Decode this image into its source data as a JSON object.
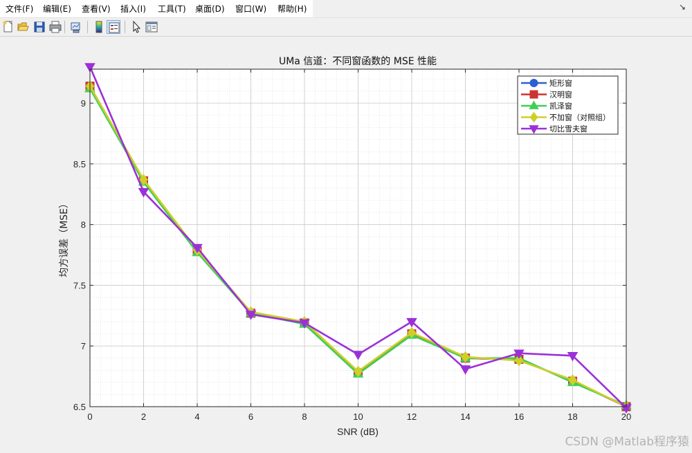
{
  "menu": {
    "items": [
      "文件(F)",
      "编辑(E)",
      "查看(V)",
      "插入(I)",
      "工具(T)",
      "桌面(D)",
      "窗口(W)",
      "帮助(H)"
    ],
    "dock_glyph": "↘"
  },
  "toolbar": {
    "buttons": [
      {
        "name": "new-figure-icon"
      },
      {
        "name": "open-file-icon"
      },
      {
        "name": "save-icon"
      },
      {
        "name": "print-icon"
      },
      {
        "name": "link-plot-icon"
      },
      {
        "name": "colorbar-icon"
      },
      {
        "name": "legend-icon",
        "pressed": true
      },
      {
        "name": "pointer-icon"
      },
      {
        "name": "property-editor-icon"
      }
    ]
  },
  "watermark": "CSDN @Matlab程序猿",
  "chart_data": {
    "type": "line",
    "title": "UMa 信道：不同窗函数的 MSE 性能",
    "xlabel": "SNR (dB)",
    "ylabel": "均方误差（MSE）",
    "x": [
      0,
      2,
      4,
      6,
      8,
      10,
      12,
      14,
      16,
      18,
      20
    ],
    "xlim": [
      0,
      20
    ],
    "ylim": [
      6.5,
      9.28
    ],
    "xticks": [
      0,
      2,
      4,
      6,
      8,
      10,
      12,
      14,
      16,
      18,
      20
    ],
    "yticks": [
      6.5,
      7,
      7.5,
      8,
      8.5,
      9
    ],
    "ytick_labels": [
      "6.5",
      "7",
      "7.5",
      "8",
      "8.5",
      "9"
    ],
    "grid": true,
    "minor_grid": true,
    "legend_position": "top-right",
    "series": [
      {
        "name": "矩形窗",
        "color": "#2e5fd1",
        "marker": "circle",
        "values": [
          9.14,
          8.36,
          7.78,
          7.27,
          7.19,
          6.78,
          7.1,
          6.9,
          6.89,
          6.71,
          6.5
        ]
      },
      {
        "name": "汉明窗",
        "color": "#cc3333",
        "marker": "square",
        "values": [
          9.14,
          8.36,
          7.78,
          7.27,
          7.19,
          6.78,
          7.1,
          6.9,
          6.89,
          6.71,
          6.5
        ]
      },
      {
        "name": "凯泽窗",
        "color": "#3fcf58",
        "marker": "triangle-up",
        "values": [
          9.12,
          8.35,
          7.77,
          7.27,
          7.18,
          6.77,
          7.09,
          6.9,
          6.9,
          6.7,
          6.51
        ]
      },
      {
        "name": "不加窗（对照组）",
        "color": "#cfcf2a",
        "marker": "diamond",
        "values": [
          9.14,
          8.37,
          7.79,
          7.28,
          7.2,
          6.79,
          7.11,
          6.91,
          6.88,
          6.72,
          6.5
        ]
      },
      {
        "name": "切比雪夫窗",
        "color": "#9b30d9",
        "marker": "triangle-down",
        "values": [
          9.3,
          8.27,
          7.81,
          7.26,
          7.19,
          6.93,
          7.2,
          6.81,
          6.94,
          6.92,
          6.49
        ]
      }
    ]
  }
}
